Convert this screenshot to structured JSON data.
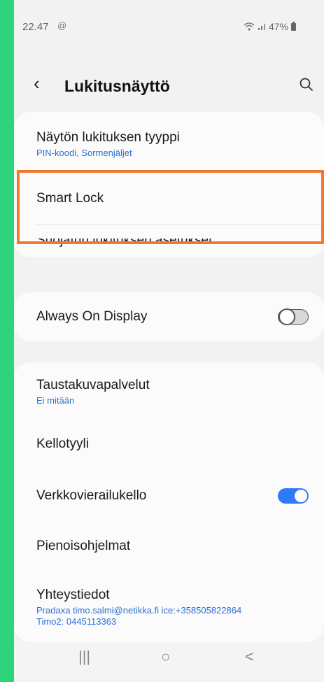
{
  "status_bar": {
    "time": "22.47",
    "time_icon": "@",
    "battery": "47%"
  },
  "header": {
    "title": "Lukitusnäyttö"
  },
  "lock_section": {
    "items": [
      {
        "label": "Näytön lukituksen tyyppi",
        "sub": "PIN-koodi, Sormenjäljet"
      },
      {
        "label": "Smart Lock"
      },
      {
        "label": "Suojatun lukituksen asetukset"
      }
    ]
  },
  "aod": {
    "label": "Always On Display",
    "enabled": false
  },
  "misc_section": {
    "wallpaper": {
      "label": "Taustakuvapalvelut",
      "sub": "Ei mitään"
    },
    "clock_style": {
      "label": "Kellotyyli"
    },
    "roaming_clock": {
      "label": "Verkkovierailukello",
      "enabled": true
    },
    "widgets": {
      "label": "Pienoisohjelmat"
    },
    "contact": {
      "label": "Yhteystiedot",
      "sub1": "Pradaxa timo.salmi@netikka.fi ice:+358505822864",
      "sub2": "Timo2: 0445113363"
    }
  },
  "navbar": {
    "recent": "|||",
    "home": "○",
    "back": "<"
  },
  "colors": {
    "accent": "#2f7bf6",
    "highlight": "#f2782c",
    "frame": "#2ed47a"
  }
}
